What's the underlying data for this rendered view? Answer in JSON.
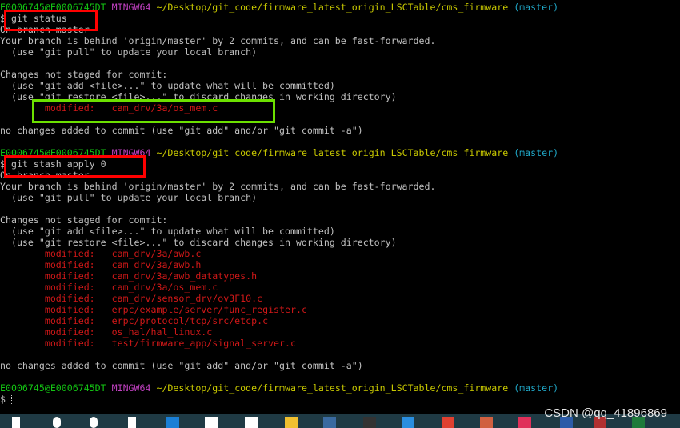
{
  "prompt": {
    "user": "E0006745@E0006745DT",
    "system": "MINGW64",
    "path": "~/Desktop/git_code/firmware_latest_origin_LSCTable/cms_firmware",
    "branch": "(master)",
    "symbol": "$"
  },
  "block1": {
    "command": "git status",
    "lines": [
      "On branch master",
      "Your branch is behind 'origin/master' by 2 commits, and can be fast-forwarded.",
      "  (use \"git pull\" to update your local branch)",
      "",
      "Changes not staged for commit:",
      "  (use \"git add <file>...\" to update what will be committed)",
      "  (use \"git restore <file>...\" to discard changes in working directory)"
    ],
    "modified": [
      {
        "label": "modified:",
        "file": "cam_drv/3a/os_mem.c"
      }
    ],
    "footer": "no changes added to commit (use \"git add\" and/or \"git commit -a\")"
  },
  "block2": {
    "command": "git stash apply 0",
    "lines": [
      "On branch master",
      "Your branch is behind 'origin/master' by 2 commits, and can be fast-forwarded.",
      "  (use \"git pull\" to update your local branch)",
      "",
      "Changes not staged for commit:",
      "  (use \"git add <file>...\" to update what will be committed)",
      "  (use \"git restore <file>...\" to discard changes in working directory)"
    ],
    "modified": [
      {
        "label": "modified:",
        "file": "cam_drv/3a/awb.c"
      },
      {
        "label": "modified:",
        "file": "cam_drv/3a/awb.h"
      },
      {
        "label": "modified:",
        "file": "cam_drv/3a/awb_datatypes.h"
      },
      {
        "label": "modified:",
        "file": "cam_drv/3a/os_mem.c"
      },
      {
        "label": "modified:",
        "file": "cam_drv/sensor_drv/ov3F10.c"
      },
      {
        "label": "modified:",
        "file": "erpc/example/server/func_register.c"
      },
      {
        "label": "modified:",
        "file": "erpc/protocol/tcp/src/etcp.c"
      },
      {
        "label": "modified:",
        "file": "os_hal/hal_linux.c"
      },
      {
        "label": "modified:",
        "file": "test/firmware_app/signal_server.c"
      }
    ],
    "footer": "no changes added to commit (use \"git add\" and/or \"git commit -a\")"
  },
  "watermark": "CSDN @qq_41896869",
  "colors": {
    "user": "#13c313",
    "system": "#c040c0",
    "path": "#c8c800",
    "branch": "#20a8c8",
    "modified": "#d01818",
    "highlight_red": "#ff0000",
    "highlight_green": "#6ce000"
  },
  "taskbar_icons": [
    "windows-start",
    "search",
    "cortana",
    "task-view",
    "edge",
    "mail",
    "store",
    "file-explorer",
    "app",
    "terminal",
    "vscode",
    "chrome",
    "sourcetree",
    "app-pink",
    "word",
    "app-red",
    "excel"
  ]
}
